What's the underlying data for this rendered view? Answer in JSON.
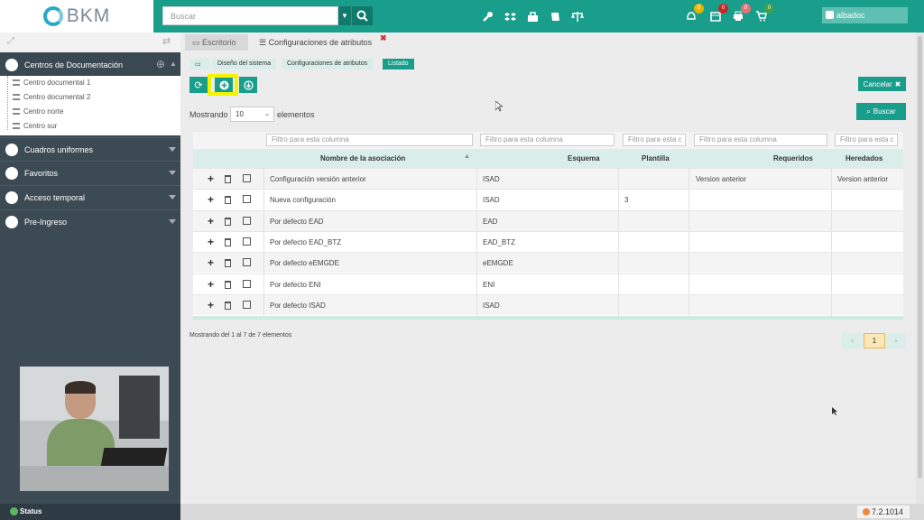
{
  "topbar": {
    "logo_text": "BKM",
    "search_placeholder": "Buscar",
    "user_name": "albadoc",
    "icons": [
      "wrench-icon",
      "dropbox-icon",
      "bag-icon",
      "book-icon",
      "balance-icon"
    ],
    "notifications": [
      {
        "icon": "bell-icon",
        "count": "0",
        "color": "#e8b400"
      },
      {
        "icon": "calendar-icon",
        "count": "0",
        "color": "#c62828"
      },
      {
        "icon": "printer-icon",
        "count": "0",
        "color": "#e57373"
      },
      {
        "icon": "cart-icon",
        "count": "0",
        "color": "#43a047"
      }
    ]
  },
  "sidebar": {
    "header": "Centros de Documentación",
    "tree": [
      "Centro documental 1",
      "Centro documental 2",
      "Centro norte",
      "Centro sur"
    ],
    "sections": [
      "Cuadros uniformes",
      "Favoritos",
      "Acceso temporal",
      "Pre-Ingreso"
    ],
    "status": "Status"
  },
  "tabs": [
    {
      "label": "Escritorio",
      "icon": "monitor-icon"
    },
    {
      "label": "Configuraciones de atributos",
      "icon": "list-icon"
    }
  ],
  "breadcrumb": [
    "Diseño del sistema",
    "Configuraciones de atributos",
    "Listado"
  ],
  "toolbar": {
    "refresh_icon": "refresh-icon",
    "add_icon": "plus-circle-icon",
    "download_icon": "download-icon",
    "cancel_label": "Cancelar",
    "search_label": "Buscar"
  },
  "length": {
    "prefix": "Mostrando",
    "value": "10",
    "suffix": "elementos"
  },
  "table": {
    "filters": [
      "Filtro para esta columna",
      "Filtro para esta columna",
      "Filtro para esta c",
      "Filtro para esta columna",
      "Filtro para esta c"
    ],
    "headers": [
      "Nombre de la asociación",
      "Esquema",
      "Plantilla",
      "Requeridos",
      "Heredados"
    ],
    "rows": [
      {
        "nombre": "Configuración versión anterior",
        "esquema": "ISAD",
        "plantilla": "",
        "requeridos": "Version anterior",
        "heredados": "Version anterior"
      },
      {
        "nombre": "Nueva configuración",
        "esquema": "ISAD",
        "plantilla": "3",
        "requeridos": "",
        "heredados": ""
      },
      {
        "nombre": "Por defecto EAD",
        "esquema": "EAD",
        "plantilla": "",
        "requeridos": "",
        "heredados": ""
      },
      {
        "nombre": "Por defecto EAD_BTZ",
        "esquema": "EAD_BTZ",
        "plantilla": "",
        "requeridos": "",
        "heredados": ""
      },
      {
        "nombre": "Por defecto eEMGDE",
        "esquema": "eEMGDE",
        "plantilla": "",
        "requeridos": "",
        "heredados": ""
      },
      {
        "nombre": "Por defecto ENI",
        "esquema": "ENI",
        "plantilla": "",
        "requeridos": "",
        "heredados": ""
      },
      {
        "nombre": "Por defecto ISAD",
        "esquema": "ISAD",
        "plantilla": "",
        "requeridos": "",
        "heredados": ""
      }
    ]
  },
  "footer": {
    "info": "Mostrando del 1 al 7 de 7 elementos",
    "page": "1",
    "prev": "‹",
    "next": "›"
  },
  "version": "7.2.1014",
  "colors": {
    "accent": "#1a9e8c",
    "sidebar": "#3c4a54",
    "highlight": "#f4f400"
  }
}
